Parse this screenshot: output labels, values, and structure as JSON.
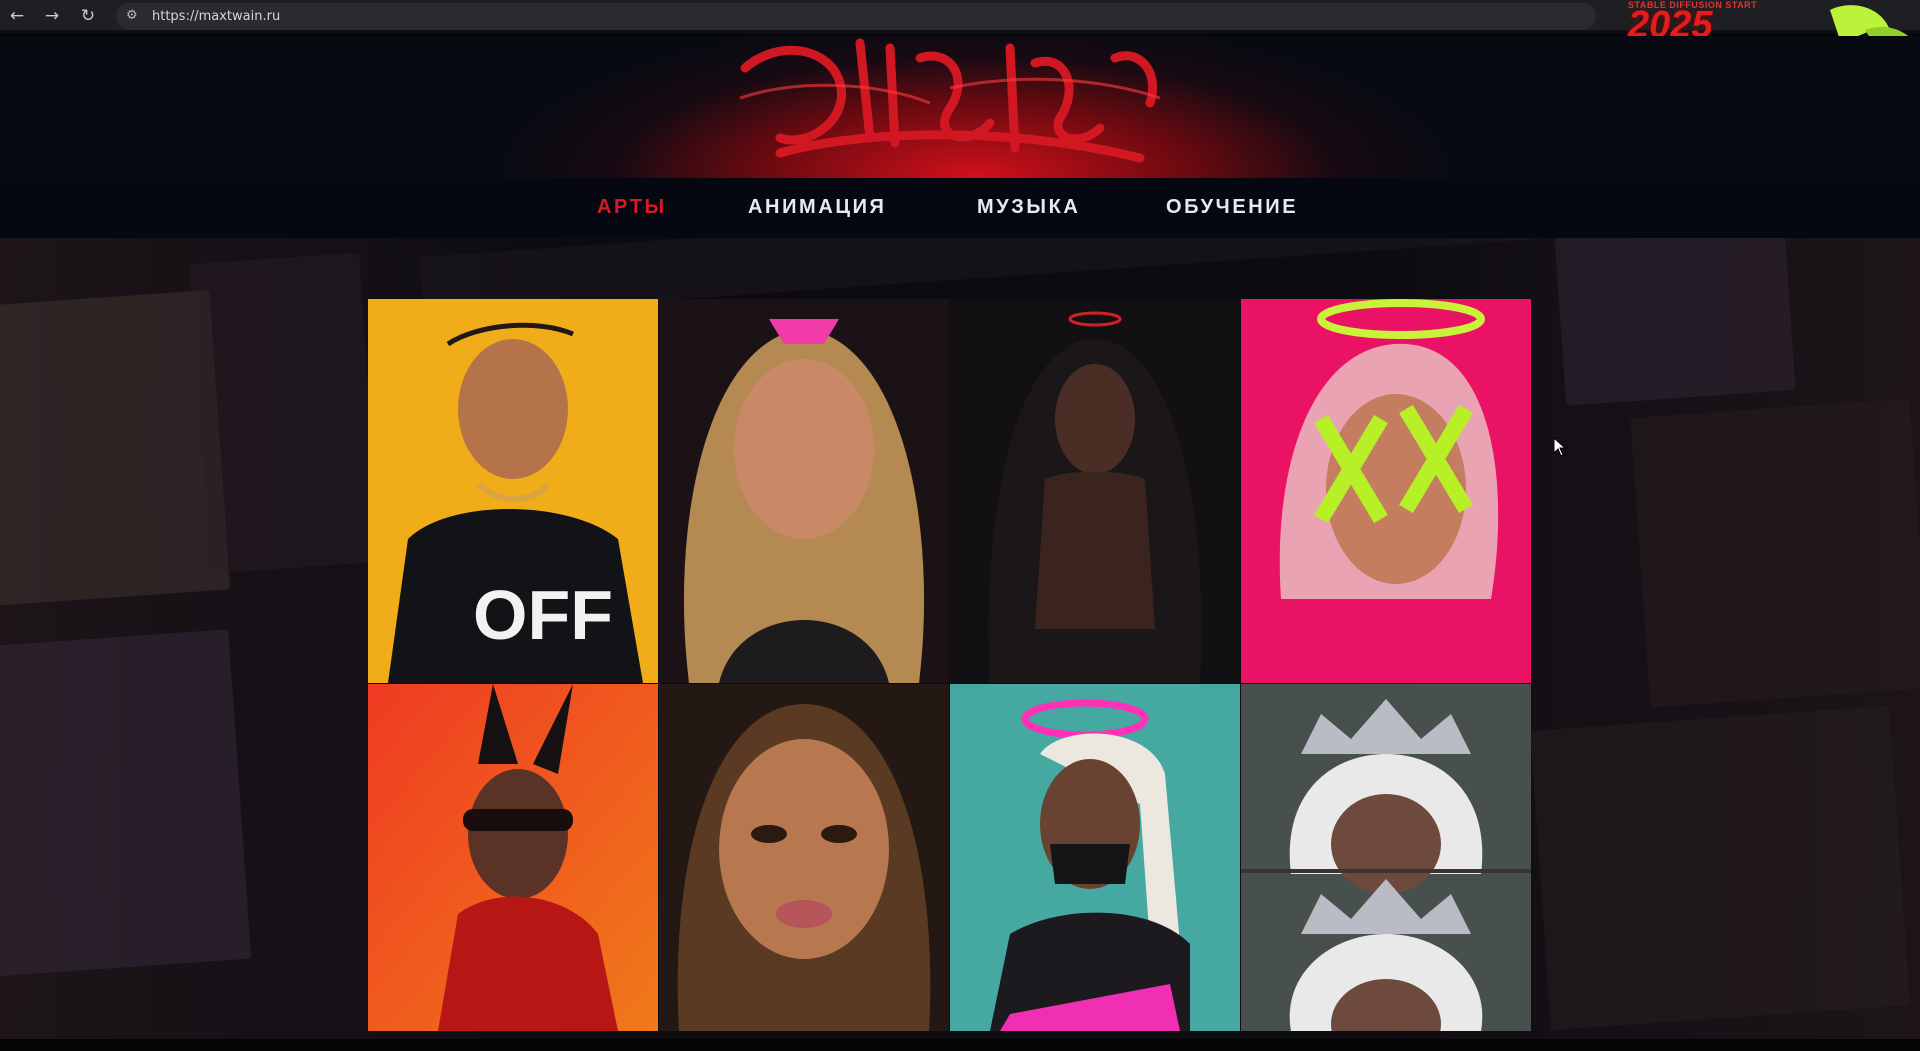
{
  "browser": {
    "url": "https://maxtwain.ru",
    "back_icon": "arrow-left",
    "forward_icon": "arrow-right",
    "reload_icon": "reload",
    "site_info_icon": "tune"
  },
  "promo": {
    "small_text": "STABLE DIFFUSION START",
    "year": "2025"
  },
  "site": {
    "logo_text": "Max Twain",
    "nav": [
      {
        "label": "АРТЫ",
        "active": true
      },
      {
        "label": "АНИМАЦИЯ",
        "active": false
      },
      {
        "label": "МУЗЫКА",
        "active": false
      },
      {
        "label": "ОБУЧЕНИЕ",
        "active": false
      }
    ]
  },
  "gallery": {
    "items": [
      {
        "name": "art-off-shirt-girl",
        "bg": "#f1ad19"
      },
      {
        "name": "art-pink-bow-girl",
        "bg": "#1a1214"
      },
      {
        "name": "art-dark-halo-girl",
        "bg": "#121012"
      },
      {
        "name": "art-neon-x-eyes-girl",
        "bg": "#ea1264"
      },
      {
        "name": "art-bunny-ears-girl",
        "bg": "#e8341f"
      },
      {
        "name": "art-dirty-virgin-girl",
        "bg": "#231813"
      },
      {
        "name": "art-pink-halo-girl",
        "bg": "#45a8a1"
      },
      {
        "name": "art-crown-girl",
        "bg": "#48504d"
      }
    ]
  },
  "colors": {
    "accent": "#d61a27",
    "nav_text": "#e9eaee",
    "page_bg": "#06080e"
  }
}
